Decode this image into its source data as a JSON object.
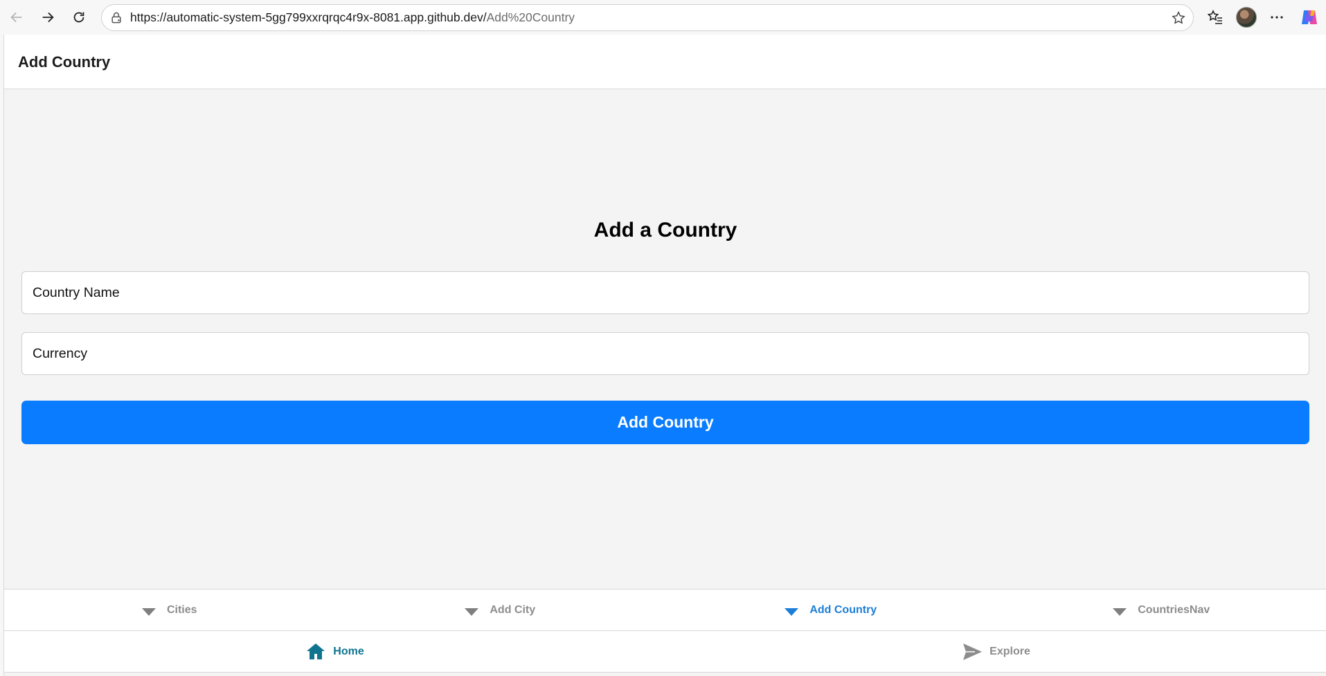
{
  "browser": {
    "url_host": "https://automatic-system-5gg799xxrqrqc4r9x-8081.app.github.dev/",
    "url_path": "Add%20Country",
    "icons": [
      "back-icon",
      "forward-icon",
      "refresh-icon",
      "lock-icon",
      "star-icon",
      "favorites-icon",
      "avatar",
      "more-icon",
      "copilot-icon"
    ]
  },
  "header": {
    "title": "Add Country"
  },
  "form": {
    "heading": "Add a Country",
    "country_name_placeholder": "Country Name",
    "currency_placeholder": "Currency",
    "submit_label": "Add Country"
  },
  "top_tabs": [
    {
      "label": "Cities",
      "active": false
    },
    {
      "label": "Add City",
      "active": false
    },
    {
      "label": "Add Country",
      "active": true
    },
    {
      "label": "CountriesNav",
      "active": false
    }
  ],
  "bottom_tabs": [
    {
      "label": "Home",
      "icon": "home-icon",
      "active": true
    },
    {
      "label": "Explore",
      "icon": "send-icon",
      "active": false
    }
  ],
  "colors": {
    "primary_button": "#0a7cff",
    "active_top_tab": "#1c7ed6",
    "active_bottom_tab": "#0e7490",
    "inactive_tab": "#8c8c8c"
  }
}
